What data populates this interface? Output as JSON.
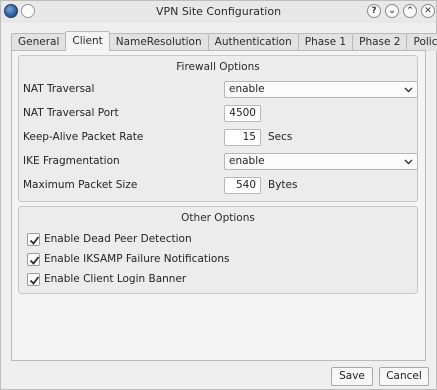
{
  "window": {
    "title": "VPN Site Configuration"
  },
  "titlebar_buttons": [
    "?",
    "⌄",
    "⌃",
    "✕"
  ],
  "tabs": [
    {
      "label": "General"
    },
    {
      "label": "Client",
      "active": true
    },
    {
      "label": "NameResolution"
    },
    {
      "label": "Authentication"
    },
    {
      "label": "Phase 1"
    },
    {
      "label": "Phase 2"
    },
    {
      "label": "Policy"
    }
  ],
  "firewall": {
    "title": "Firewall Options",
    "nat_traversal": {
      "label": "NAT Traversal",
      "value": "enable"
    },
    "nat_port": {
      "label": "NAT Traversal Port",
      "value": "4500"
    },
    "keepalive": {
      "label": "Keep-Alive Packet Rate",
      "value": "15",
      "unit": "Secs"
    },
    "ike_frag": {
      "label": "IKE Fragmentation",
      "value": "enable"
    },
    "max_packet": {
      "label": "Maximum Packet Size",
      "value": "540",
      "unit": "Bytes"
    }
  },
  "other": {
    "title": "Other Options",
    "options": [
      {
        "label": "Enable Dead Peer Detection",
        "checked": true
      },
      {
        "label": "Enable IKSAMP Failure Notifications",
        "checked": true
      },
      {
        "label": "Enable Client Login Banner",
        "checked": true
      }
    ]
  },
  "buttons": {
    "save": "Save",
    "cancel": "Cancel"
  },
  "icons": [
    "app-icon",
    "help-icon",
    "minimize-icon",
    "maximize-icon",
    "close-icon",
    "chevron-down-icon",
    "checkmark-icon"
  ]
}
